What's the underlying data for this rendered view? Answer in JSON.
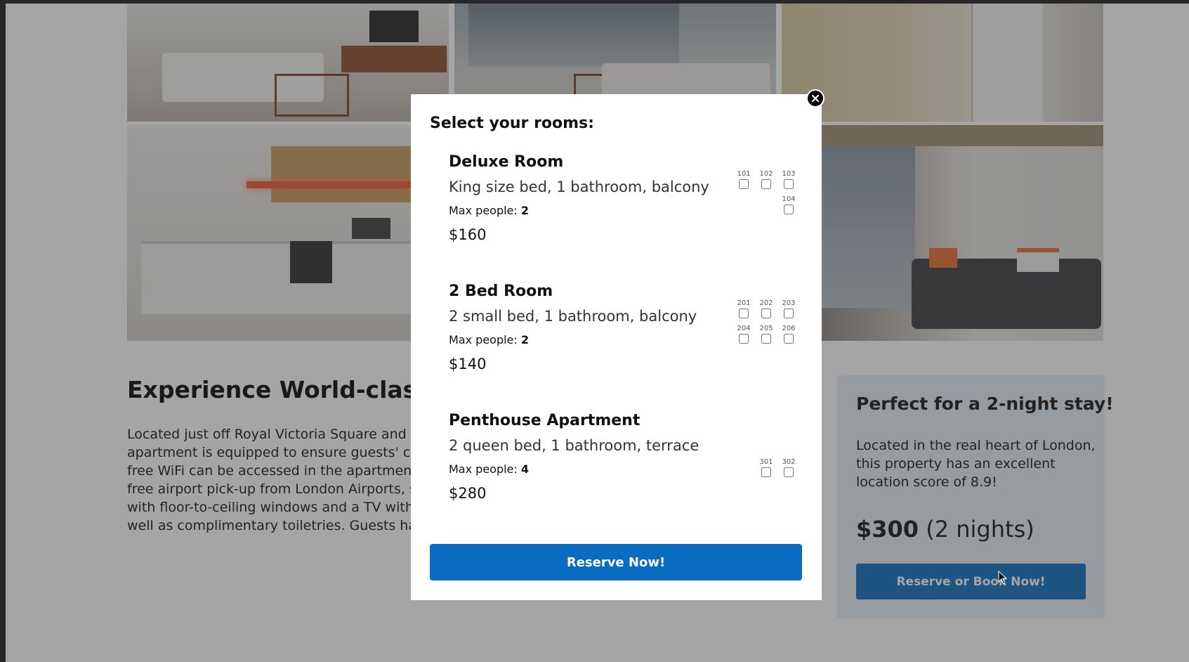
{
  "page": {
    "heading": "Experience World-class Se",
    "description_lines": [
      "Located just off Royal Victoria Square and with",
      "apartment is equipped to ensure guests' com",
      "free WiFi can be accessed in the apartment. A",
      "free airport pick-up from London Airports, sub",
      "with floor-to-ceiling windows and a TV with sa",
      "well as complimentary toiletries. Guests have"
    ]
  },
  "sidebar": {
    "title": "Perfect for a 2-night stay!",
    "text_lines": [
      "Located in the real heart of London,",
      "this property has an excellent",
      "location score of 8.9!"
    ],
    "price": "$300",
    "price_note": "(2 nights)",
    "button_label": "Reserve or Book Now!"
  },
  "modal": {
    "title": "Select your rooms:",
    "max_label": "Max people:",
    "reserve_label": "Reserve Now!",
    "rooms": [
      {
        "name": "Deluxe Room",
        "desc": "King size bed, 1 bathroom, balcony",
        "max": "2",
        "price": "$160",
        "numbers": [
          "101",
          "102",
          "103",
          "104"
        ]
      },
      {
        "name": "2 Bed Room",
        "desc": "2 small bed, 1 bathroom, balcony",
        "max": "2",
        "price": "$140",
        "numbers": [
          "201",
          "202",
          "203",
          "204",
          "205",
          "206"
        ]
      },
      {
        "name": "Penthouse Apartment",
        "desc": "2 queen bed, 1 bathroom, terrace",
        "max": "4",
        "price": "$280",
        "numbers": [
          "301",
          "302"
        ]
      }
    ]
  },
  "icons": {
    "close": "close-icon",
    "cursor": "mouse-pointer-icon"
  },
  "colors": {
    "primary_button": "#0a6cc0",
    "sidebar_bg": "#e6eef6"
  }
}
